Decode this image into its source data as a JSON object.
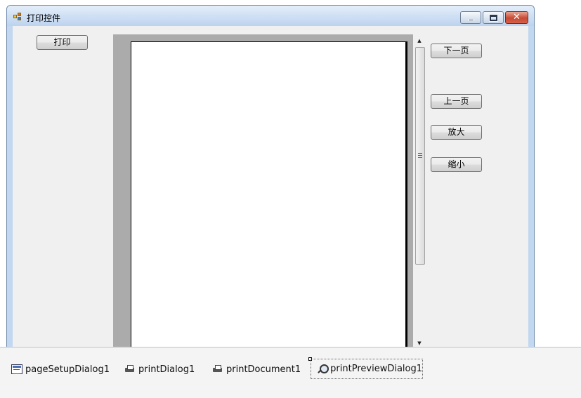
{
  "window": {
    "title": "打印控件",
    "icon": "app-form-icon"
  },
  "buttons": {
    "print": "打印",
    "next_page": "下一页",
    "prev_page": "上一页",
    "zoom_in": "放大",
    "zoom_out": "缩小"
  },
  "tray": {
    "items": [
      {
        "label": "pageSetupDialog1",
        "icon": "page-setup-icon"
      },
      {
        "label": "printDialog1",
        "icon": "printer-icon"
      },
      {
        "label": "printDocument1",
        "icon": "printer-icon"
      },
      {
        "label": "printPreviewDialog1",
        "icon": "print-preview-icon"
      }
    ],
    "selected_index": 3
  },
  "colors": {
    "preview_background": "#ababab",
    "close_button": "#c74a33",
    "title_gradient_top": "#e4eefa"
  }
}
